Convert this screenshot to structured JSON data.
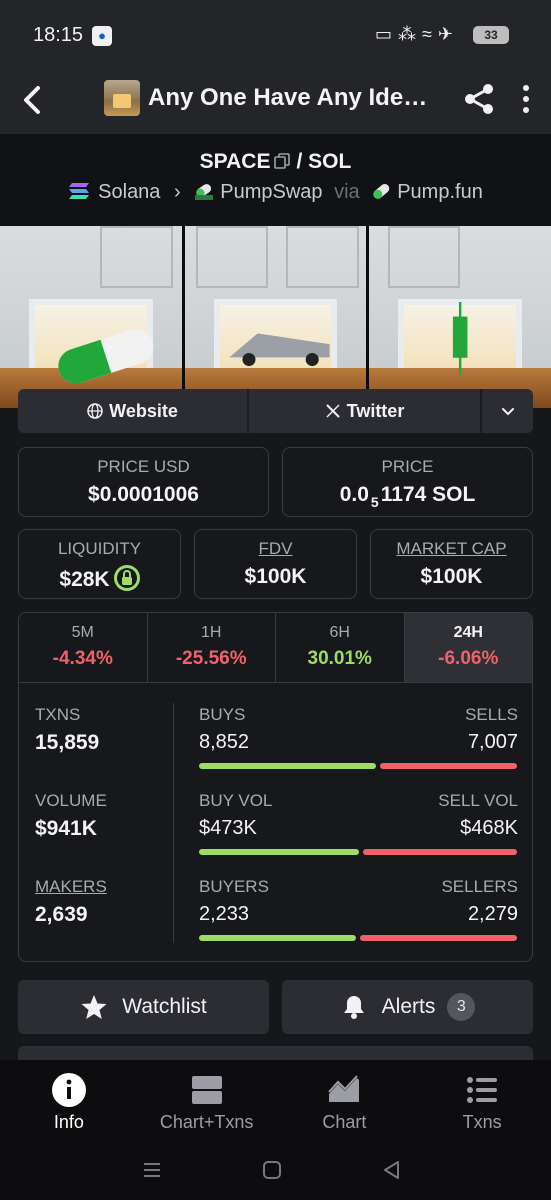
{
  "status_bar": {
    "time": "18:15",
    "battery": "33"
  },
  "app_bar": {
    "title": "Any One Have Any Ide…"
  },
  "token": {
    "symbol": "SPACE",
    "quote": "SOL",
    "separator": "/",
    "chain": "Solana",
    "dex": "PumpSwap",
    "via": "via",
    "launchpad": "Pump.fun"
  },
  "links": {
    "website": "Website",
    "twitter": "Twitter"
  },
  "price": {
    "usd_label": "PRICE USD",
    "usd_value": "$0.0001006",
    "native_label": "PRICE",
    "native_prefix": "0.0",
    "native_sub": "5",
    "native_rest": "1174 SOL"
  },
  "metrics": {
    "liquidity_label": "LIQUIDITY",
    "liquidity_value": "$28K",
    "fdv_label": "FDV",
    "fdv_value": "$100K",
    "mcap_label": "MARKET CAP",
    "mcap_value": "$100K"
  },
  "timeframes": [
    {
      "label": "5M",
      "value": "-4.34%",
      "trend": "neg"
    },
    {
      "label": "1H",
      "value": "-25.56%",
      "trend": "neg"
    },
    {
      "label": "6H",
      "value": "30.01%",
      "trend": "pos"
    },
    {
      "label": "24H",
      "value": "-6.06%",
      "trend": "neg",
      "active": true
    }
  ],
  "stats": {
    "txns": {
      "label": "TXNS",
      "value": "15,859",
      "left_label": "BUYS",
      "left_value": "8,852",
      "right_label": "SELLS",
      "right_value": "7,007",
      "left_share": 0.558
    },
    "volume": {
      "label": "VOLUME",
      "value": "$941K",
      "left_label": "BUY VOL",
      "left_value": "$473K",
      "right_label": "SELL VOL",
      "right_value": "$468K",
      "left_share": 0.503
    },
    "makers": {
      "label": "MAKERS",
      "value": "2,639",
      "left_label": "BUYERS",
      "left_value": "2,233",
      "right_label": "SELLERS",
      "right_value": "2,279",
      "left_share": 0.495
    }
  },
  "actions": {
    "watchlist": "Watchlist",
    "alerts": "Alerts",
    "alerts_count": "3"
  },
  "bottom_nav": {
    "info": "Info",
    "chart_txns": "Chart+Txns",
    "chart": "Chart",
    "txns": "Txns"
  },
  "colors": {
    "positive": "#9fdc63",
    "negative": "#f0616a",
    "background": "#16171b",
    "surface": "#2c2d33"
  }
}
